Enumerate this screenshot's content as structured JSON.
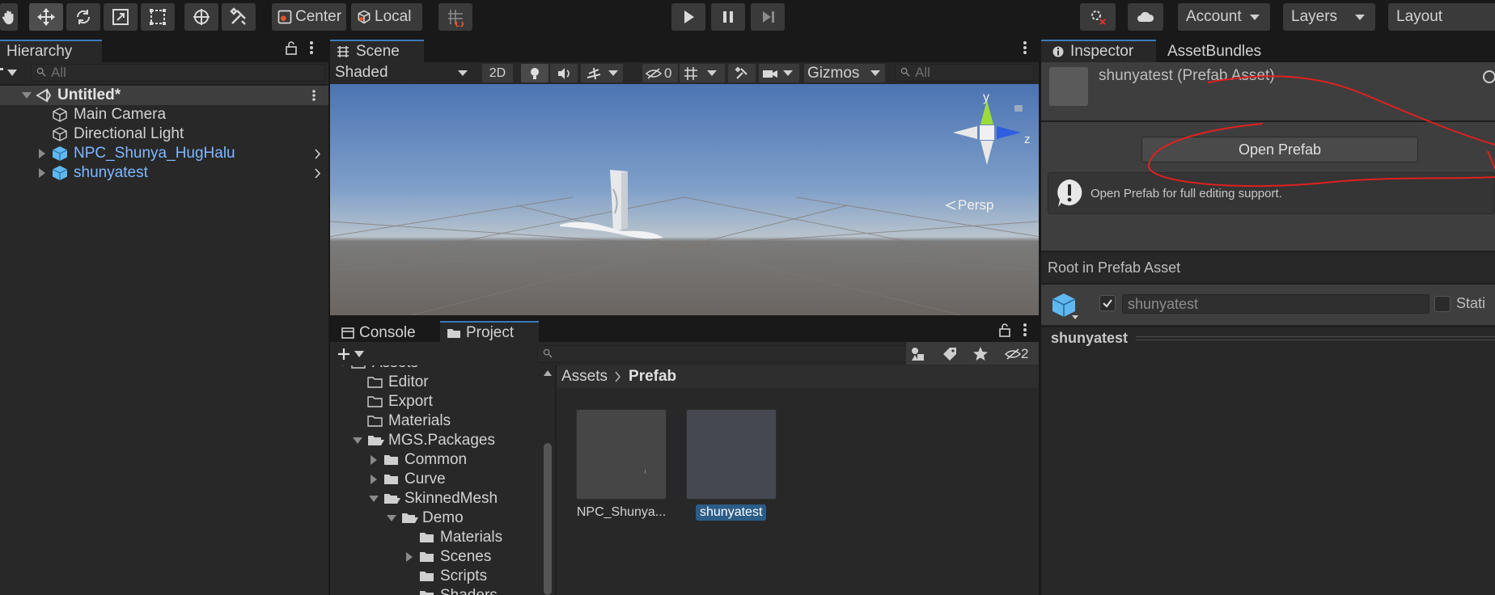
{
  "toolbar": {
    "pivot_label": "Center",
    "space_label": "Local",
    "account_label": "Account",
    "layers_label": "Layers",
    "layout_label": "Layout"
  },
  "hierarchy": {
    "tab_label": "Hierarchy",
    "search_placeholder": "All",
    "scene_name": "Untitled*",
    "items": [
      {
        "label": "Main Camera",
        "type": "gameobject"
      },
      {
        "label": "Directional Light",
        "type": "gameobject"
      },
      {
        "label": "NPC_Shunya_HugHalu",
        "type": "prefab"
      },
      {
        "label": "shunyatest",
        "type": "prefab"
      }
    ]
  },
  "scene": {
    "tab_label": "Scene",
    "shading_mode": "Shaded",
    "mode_2d": "2D",
    "hidden_count": "0",
    "gizmos_label": "Gizmos",
    "search_placeholder": "All",
    "gizmo_y": "y",
    "gizmo_z": "z",
    "projection": "Persp"
  },
  "project": {
    "console_tab": "Console",
    "project_tab": "Project",
    "hidden_count": "2",
    "breadcrumb_root": "Assets",
    "breadcrumb_current": "Prefab",
    "tree": [
      {
        "label": "Assets",
        "depth": 0,
        "expander": "down"
      },
      {
        "label": "Editor",
        "depth": 1,
        "expander": "none",
        "folder": "outline"
      },
      {
        "label": "Export",
        "depth": 1,
        "expander": "none",
        "folder": "outline"
      },
      {
        "label": "Materials",
        "depth": 1,
        "expander": "none",
        "folder": "outline"
      },
      {
        "label": "MGS.Packages",
        "depth": 1,
        "expander": "down",
        "folder": "open"
      },
      {
        "label": "Common",
        "depth": 2,
        "expander": "right",
        "folder": "filled"
      },
      {
        "label": "Curve",
        "depth": 2,
        "expander": "right",
        "folder": "filled"
      },
      {
        "label": "SkinnedMesh",
        "depth": 2,
        "expander": "down",
        "folder": "open"
      },
      {
        "label": "Demo",
        "depth": 3,
        "expander": "down",
        "folder": "open"
      },
      {
        "label": "Materials",
        "depth": 4,
        "expander": "none",
        "folder": "filled"
      },
      {
        "label": "Scenes",
        "depth": 4,
        "expander": "right",
        "folder": "filled"
      },
      {
        "label": "Scripts",
        "depth": 4,
        "expander": "none",
        "folder": "filled"
      },
      {
        "label": "Shaders",
        "depth": 4,
        "expander": "none",
        "folder": "filled"
      }
    ],
    "assets": [
      {
        "label": "NPC_Shunya...",
        "selected": false
      },
      {
        "label": "shunyatest",
        "selected": true
      }
    ]
  },
  "inspector": {
    "tab_label": "Inspector",
    "assetbundles_tab": "AssetBundles",
    "asset_title": "shunyatest (Prefab Asset)",
    "open_prefab_button": "Open Prefab",
    "help_text": "Open Prefab for full editing support.",
    "root_header": "Root in Prefab Asset",
    "object_name": "shunyatest",
    "static_label": "Stati",
    "component_header": "shunyatest"
  },
  "colors": {
    "accent": "#3a79bb",
    "prefab_text": "#7fb7ff",
    "annotation": "#e02020"
  }
}
